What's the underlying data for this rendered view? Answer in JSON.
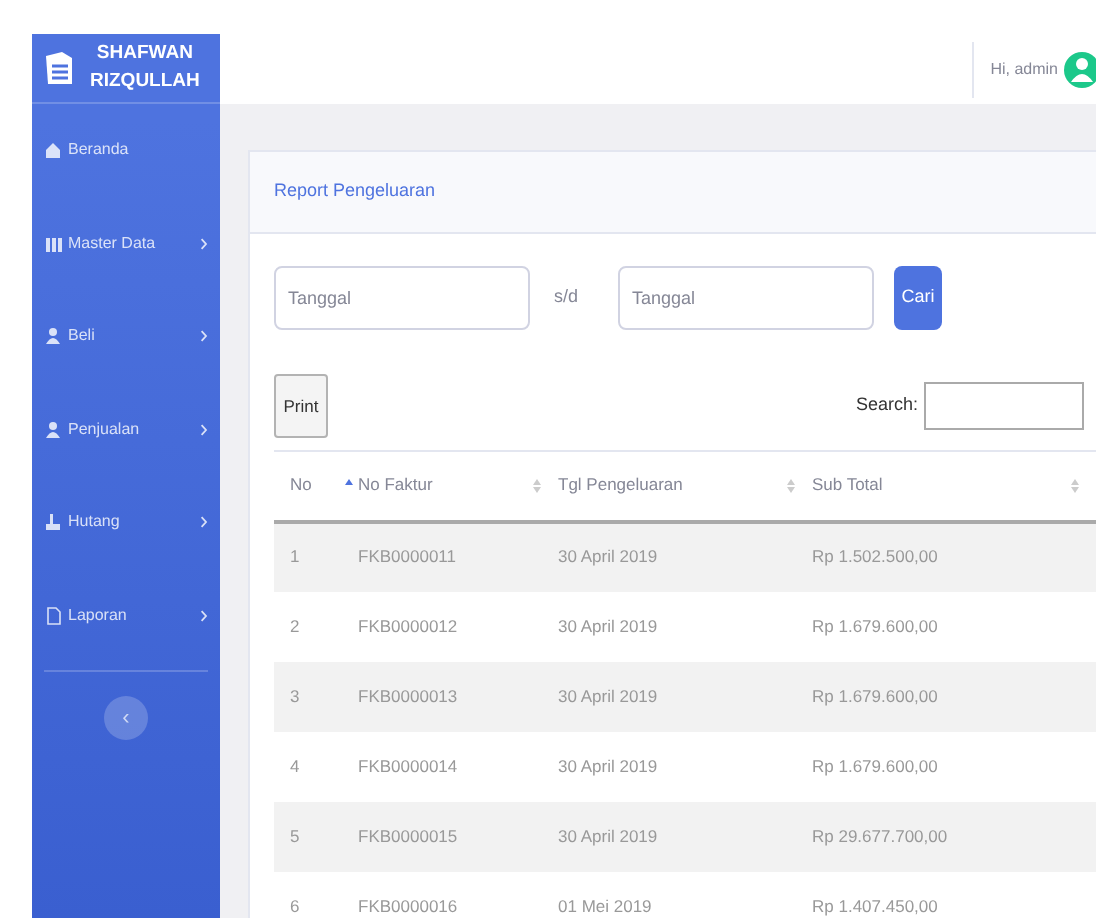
{
  "brand": {
    "line_1": "SHAFWAN",
    "line_2": "RIZQULLAH"
  },
  "topbar": {
    "greeting": "Hi, admin"
  },
  "sidebar": {
    "items": [
      {
        "label": "Beranda",
        "has_submenu": false
      },
      {
        "label": "Master Data",
        "has_submenu": true
      },
      {
        "label": "Beli",
        "has_submenu": true
      },
      {
        "label": "Penjualan",
        "has_submenu": true
      },
      {
        "label": "Hutang",
        "has_submenu": true
      },
      {
        "label": "Laporan",
        "has_submenu": true
      }
    ],
    "toggle": "‹"
  },
  "card": {
    "title": "Report Pengeluaran",
    "date_from": {
      "placeholder": "Tanggal"
    },
    "separator": "s/d",
    "date_to": {
      "placeholder": "Tanggal"
    },
    "search_button": "Cari",
    "print_button": "Print",
    "search_label": "Search:",
    "table": {
      "columns": [
        {
          "label": "No",
          "sorted": true
        },
        {
          "label": "No Faktur",
          "sorted": false
        },
        {
          "label": "Tgl Pengeluaran",
          "sorted": false
        },
        {
          "label": "Sub Total",
          "sorted": false
        }
      ],
      "rows": [
        [
          "1",
          "FKB0000011",
          "30 April 2019",
          "Rp 1.502.500,00"
        ],
        [
          "2",
          "FKB0000012",
          "30 April 2019",
          "Rp 1.679.600,00"
        ],
        [
          "3",
          "FKB0000013",
          "30 April 2019",
          "Rp 1.679.600,00"
        ],
        [
          "4",
          "FKB0000014",
          "30 April 2019",
          "Rp 1.679.600,00"
        ],
        [
          "5",
          "FKB0000015",
          "30 April 2019",
          "Rp 29.677.700,00"
        ],
        [
          "6",
          "FKB0000016",
          "01 Mei 2019",
          "Rp 1.407.450,00"
        ]
      ]
    }
  }
}
